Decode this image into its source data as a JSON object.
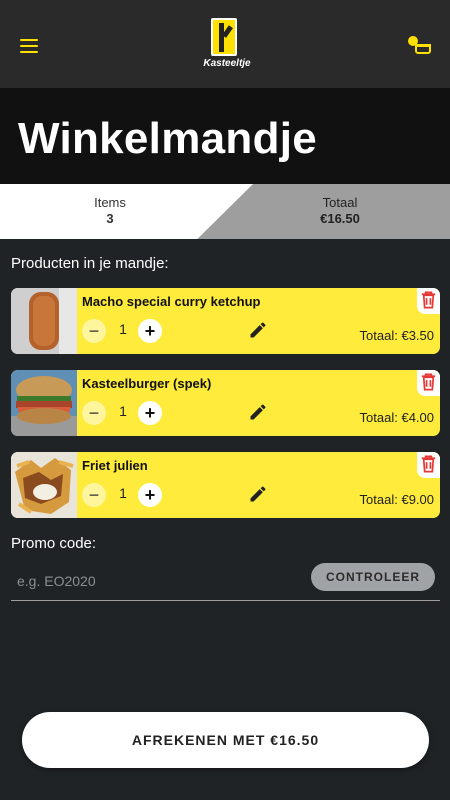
{
  "app": {
    "logo_text": "Kasteeltje"
  },
  "page": {
    "title": "Winkelmandje"
  },
  "summary": {
    "items_label": "Items",
    "items_value": "3",
    "total_label": "Totaal",
    "total_value": "€16.50"
  },
  "cart": {
    "heading": "Producten in je mandje:",
    "products": [
      {
        "name": "Macho special curry ketchup",
        "qty": "1",
        "total": "Totaal: €3.50",
        "minus": "−",
        "plus": "+"
      },
      {
        "name": "Kasteelburger (spek)",
        "qty": "1",
        "total": "Totaal: €4.00",
        "minus": "−",
        "plus": "+"
      },
      {
        "name": "Friet julien",
        "qty": "1",
        "total": "Totaal: €9.00",
        "minus": "−",
        "plus": "+"
      }
    ]
  },
  "promo": {
    "label": "Promo code:",
    "placeholder": "e.g. EO2020",
    "button": "CONTROLEER"
  },
  "checkout": {
    "button": "AFREKENEN MET €16.50"
  },
  "icons": {
    "menu": "menu-icon",
    "cart": "cart-icon",
    "edit": "pencil-icon",
    "delete": "trash-icon"
  },
  "colors": {
    "accent": "#ffe000",
    "card": "#ffeb3b",
    "delete": "#e53935",
    "background": "#1f2326"
  }
}
